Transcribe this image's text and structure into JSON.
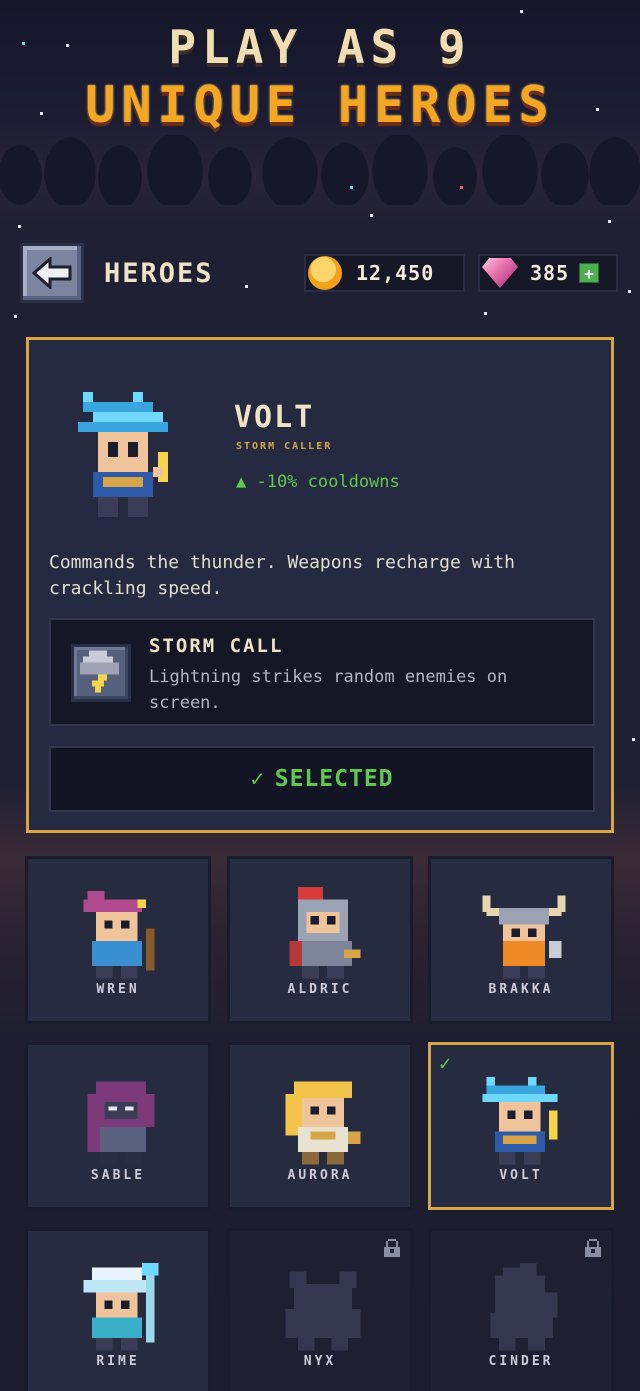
{
  "promo": {
    "line1": "PLAY AS 9",
    "line2": "UNIQUE HEROES"
  },
  "topbar": {
    "back_icon": "arrow-left-icon",
    "title": "HEROES",
    "coins": "12,450",
    "gems": "385",
    "add_gems_label": "+"
  },
  "selected_hero": {
    "name": "VOLT",
    "class": "STORM CALLER",
    "perk": "▲ -10% cooldowns",
    "description": "Commands the thunder. Weapons recharge with crackling speed.",
    "ability": {
      "icon": "storm-cloud-icon",
      "name": "STORM CALL",
      "description": "Lightning strikes random enemies on screen."
    },
    "status_button": "SELECTED",
    "status_icon": "✓"
  },
  "heroes": [
    {
      "name": "WREN",
      "locked": false,
      "selected": false
    },
    {
      "name": "ALDRIC",
      "locked": false,
      "selected": false
    },
    {
      "name": "BRAKKA",
      "locked": false,
      "selected": false
    },
    {
      "name": "SABLE",
      "locked": false,
      "selected": false
    },
    {
      "name": "AURORA",
      "locked": false,
      "selected": false
    },
    {
      "name": "VOLT",
      "locked": false,
      "selected": true,
      "check": "✓"
    },
    {
      "name": "RIME",
      "locked": false,
      "selected": false
    },
    {
      "name": "NYX",
      "locked": true,
      "selected": false
    },
    {
      "name": "CINDER",
      "locked": true,
      "selected": false
    }
  ],
  "colors": {
    "accent_gold": "#d7a548",
    "success_green": "#5fc94e",
    "title_orange": "#f5a623",
    "card_bg": "#262a40"
  }
}
